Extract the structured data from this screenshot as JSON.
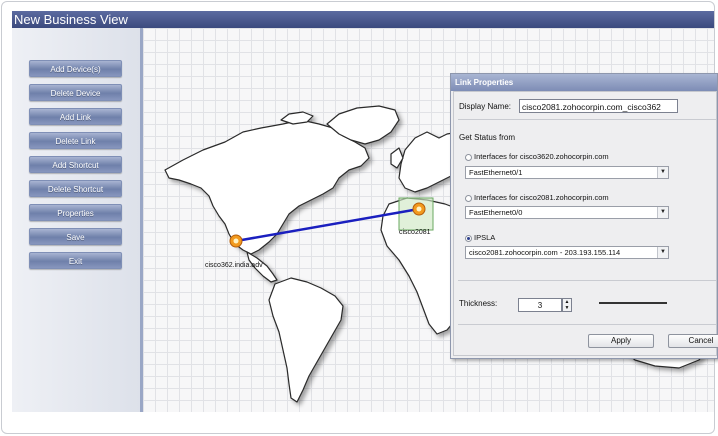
{
  "window": {
    "title": "New Business View"
  },
  "sidebar": {
    "buttons": [
      {
        "label": "Add Device(s)"
      },
      {
        "label": "Delete Device"
      },
      {
        "label": "Add Link"
      },
      {
        "label": "Delete Link"
      },
      {
        "label": "Add Shortcut"
      },
      {
        "label": "Delete Shortcut"
      },
      {
        "label": "Properties"
      },
      {
        "label": "Save"
      },
      {
        "label": "Exit"
      }
    ]
  },
  "map": {
    "link_color": "#1a1fbf",
    "node_color": "#f29a1e",
    "nodes": [
      {
        "label": "cisco362.india.adv"
      },
      {
        "label": "cisco2081"
      }
    ]
  },
  "dialog": {
    "title": "Link Properties",
    "display_name_label": "Display Name:",
    "display_name_value": "cisco2081.zohocorpin.com_cisco362",
    "get_status_label": "Get Status from",
    "options": [
      {
        "label": "Interfaces for cisco3620.zohocorpin.com",
        "selected": false,
        "combo_value": "FastEthernet0/1"
      },
      {
        "label": "Interfaces for cisco2081.zohocorpin.com",
        "selected": false,
        "combo_value": "FastEthernet0/0"
      },
      {
        "label": "IPSLA",
        "selected": true,
        "combo_value": "cisco2081.zohocorpin.com - 203.193.155.114"
      }
    ],
    "thickness_label": "Thickness:",
    "thickness_value": "3",
    "apply_label": "Apply",
    "cancel_label": "Cancel"
  }
}
